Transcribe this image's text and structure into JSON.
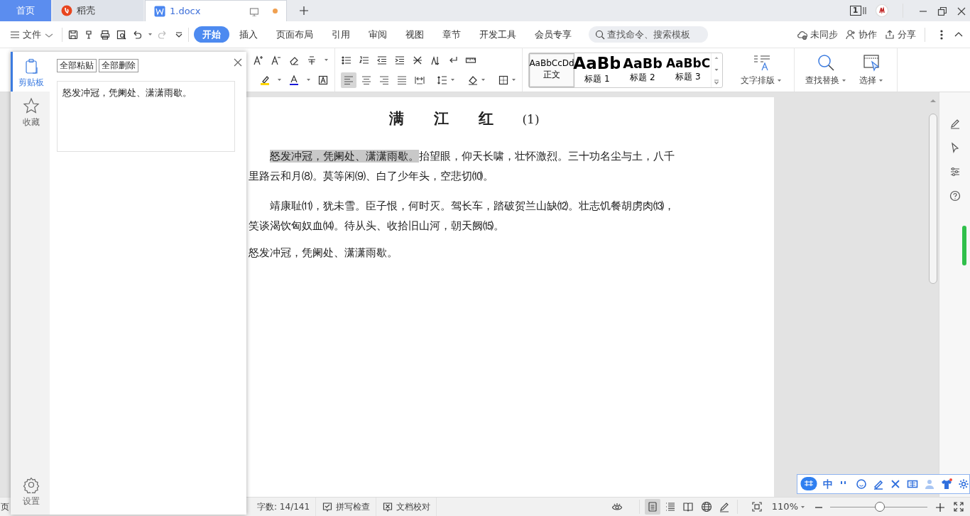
{
  "tabs": [
    {
      "label": "首页",
      "kind": "home",
      "selected": false
    },
    {
      "label": "稻壳",
      "kind": "app",
      "selected": false
    },
    {
      "label": "1.docx",
      "kind": "doc",
      "selected": true,
      "unsaved": true
    }
  ],
  "title_bar": {
    "page_badge": "1"
  },
  "menu": {
    "file_label": "文件",
    "ribbon_tabs": [
      {
        "label": "开始",
        "selected": true
      },
      {
        "label": "插入",
        "selected": false
      },
      {
        "label": "页面布局",
        "selected": false
      },
      {
        "label": "引用",
        "selected": false
      },
      {
        "label": "审阅",
        "selected": false
      },
      {
        "label": "视图",
        "selected": false
      },
      {
        "label": "章节",
        "selected": false
      },
      {
        "label": "开发工具",
        "selected": false
      },
      {
        "label": "会员专享",
        "selected": false
      }
    ],
    "search": {
      "placeholder": "查找命令、搜索模板"
    },
    "actions": [
      {
        "label": "未同步",
        "kind": "cloud"
      },
      {
        "label": "协作",
        "kind": "person"
      },
      {
        "label": "分享",
        "kind": "share"
      }
    ]
  },
  "toolbar": {
    "alignment": [
      {
        "kind": "left",
        "selected": true
      },
      {
        "kind": "center",
        "selected": false
      },
      {
        "kind": "right",
        "selected": false
      },
      {
        "kind": "justify",
        "selected": false
      },
      {
        "kind": "distributed",
        "selected": false
      }
    ],
    "styles": [
      {
        "preview": "AaBbCcDd",
        "label": "正文",
        "kind": "body",
        "selected": true
      },
      {
        "preview": "AaBb",
        "label": "标题 1",
        "kind": "h1",
        "selected": false
      },
      {
        "preview": "AaBb",
        "label": "标题 2",
        "kind": "h2",
        "selected": false
      },
      {
        "preview": "AaBbC",
        "label": "标题 3",
        "kind": "h3",
        "selected": false
      }
    ],
    "big_buttons": [
      {
        "label": "文字排版",
        "kind": "layout"
      },
      {
        "label": "查找替换",
        "kind": "find"
      },
      {
        "label": "选择",
        "kind": "select"
      }
    ]
  },
  "clipboard_panel": {
    "rail": [
      {
        "label": "剪贴板",
        "kind": "clipboard",
        "selected": true
      },
      {
        "label": "收藏",
        "kind": "star",
        "selected": false
      }
    ],
    "settings_label": "设置",
    "actions": [
      "全部粘贴",
      "全部删除"
    ],
    "items": [
      "怒发冲冠，凭阑处、潇潇雨歇。"
    ]
  },
  "document": {
    "title": "满　　江　　红",
    "title_note": "(1)",
    "paragraphs": [
      {
        "indent": true,
        "segments": [
          {
            "text": "怒发冲冠，凭阑处、潇潇雨歇。",
            "highlighted": true
          },
          {
            "text": "抬望眼，仰天长啸，壮怀激烈。三十功名尘与土，八千里路云和月⑻。莫等闲⑼、白了少年头，空悲切⑽。",
            "highlighted": false
          }
        ]
      },
      {
        "indent": true,
        "segments": [
          {
            "text": "靖康耻⑾，犹未雪。臣子恨，何时灭。驾长车，踏破贺兰山缺⑿。壮志饥餐胡虏肉⒀，笑谈渴饮匈奴血⒁。待从头、收拾旧山河，朝天阙⒂。",
            "highlighted": false
          }
        ]
      },
      {
        "indent": false,
        "segments": [
          {
            "text": "怒发冲冠，凭阑处、潇潇雨歇。",
            "highlighted": false
          }
        ]
      }
    ]
  },
  "status_bar": {
    "page_label": "页",
    "word_count": "字数: 14/141",
    "tools": [
      {
        "label": "拼写检查",
        "kind": "check"
      },
      {
        "label": "文档校对",
        "kind": "cross"
      }
    ],
    "view_modes": [
      {
        "kind": "page",
        "selected": true
      },
      {
        "kind": "outline",
        "selected": false
      },
      {
        "kind": "read",
        "selected": false
      },
      {
        "kind": "web",
        "selected": false
      },
      {
        "kind": "pen",
        "selected": false
      }
    ],
    "zoom": "110%",
    "zoom_slider": {
      "level": 0.51
    }
  },
  "ime_bar": {
    "label": "中"
  }
}
